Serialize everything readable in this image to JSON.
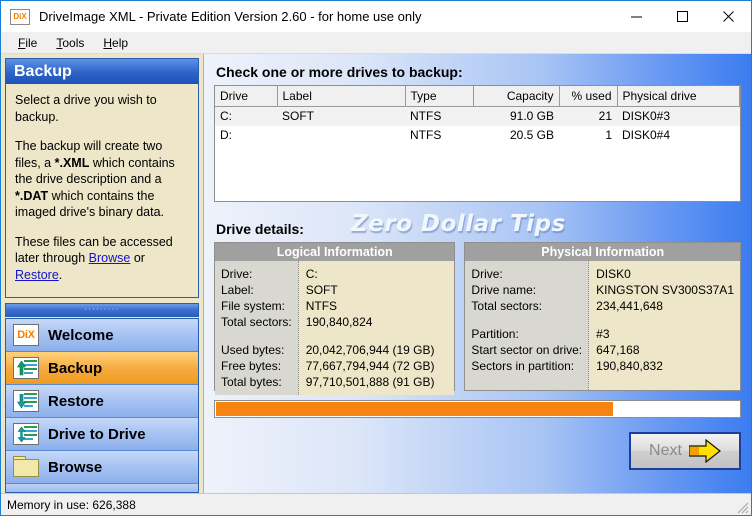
{
  "window": {
    "icon": "dix-app-icon",
    "icon_text": "DiX",
    "title": "DriveImage XML - Private Edition Version 2.60 - for home use only",
    "controls": {
      "minimize": "minimize-icon",
      "maximize": "maximize-icon",
      "close": "close-icon"
    }
  },
  "menubar": {
    "items": [
      {
        "label": "File",
        "accel": "F"
      },
      {
        "label": "Tools",
        "accel": "T"
      },
      {
        "label": "Help",
        "accel": "H"
      }
    ]
  },
  "sidebar": {
    "panel": {
      "title": "Backup",
      "paragraph1": "Select a drive you wish to backup.",
      "paragraph2_a": "The backup will create two files, a ",
      "paragraph2_b": "*.XML",
      "paragraph2_c": " which contains the drive description and a ",
      "paragraph2_d": "*.DAT",
      "paragraph2_e": " which contains the imaged drive's binary data.",
      "paragraph3_a": "These files can be accessed later through ",
      "link_browse": "Browse",
      "paragraph3_b": " or ",
      "link_restore": "Restore",
      "paragraph3_c": "."
    },
    "grip_dots": "·········",
    "items": [
      {
        "label": "Welcome",
        "icon": "dix-icon",
        "active": false
      },
      {
        "label": "Backup",
        "icon": "backup-arrow-up-icon",
        "active": true
      },
      {
        "label": "Restore",
        "icon": "restore-arrow-down-icon",
        "active": false
      },
      {
        "label": "Drive to Drive",
        "icon": "drive-to-drive-icon",
        "active": false
      },
      {
        "label": "Browse",
        "icon": "folder-icon",
        "active": false
      }
    ]
  },
  "main": {
    "table_title": "Check one or more drives to backup:",
    "table": {
      "columns": [
        "Drive",
        "Label",
        "Type",
        "Capacity",
        "% used",
        "Physical drive"
      ],
      "rows": [
        {
          "drive": "C:",
          "label": "SOFT",
          "type": "NTFS",
          "capacity": "91.0 GB",
          "used": "21",
          "physical": "DISK0#3",
          "selected": true
        },
        {
          "drive": "D:",
          "label": "",
          "type": "NTFS",
          "capacity": "20.5 GB",
          "used": "1",
          "physical": "DISK0#4",
          "selected": false
        }
      ]
    },
    "details_title": "Drive details:",
    "watermark": "Zero Dollar Tips",
    "logical": {
      "header": "Logical Information",
      "keys": [
        "Drive:",
        "Label:",
        "File system:",
        "Total sectors:",
        "Used bytes:",
        "Free bytes:",
        "Total bytes:"
      ],
      "values": [
        "C:",
        "SOFT",
        "NTFS",
        "190,840,824",
        "20,042,706,944 (19 GB)",
        "77,667,794,944 (72 GB)",
        "97,710,501,888 (91 GB)"
      ]
    },
    "physical": {
      "header": "Physical Information",
      "keys": [
        "Drive:",
        "Drive name:",
        "Total sectors:",
        "Partition:",
        "Start sector on drive:",
        "Sectors in partition:"
      ],
      "values": [
        "DISK0",
        "KINGSTON SV300S37A1",
        "234,441,648",
        "#3",
        "647,168",
        "190,840,832"
      ]
    },
    "progress": {
      "percent": 76,
      "color": "#f58410"
    },
    "next_button": {
      "label": "Next",
      "icon": "arrow-right-icon"
    }
  },
  "statusbar": {
    "text": "Memory in use: 626,388",
    "grip": "resize-grip-icon"
  }
}
